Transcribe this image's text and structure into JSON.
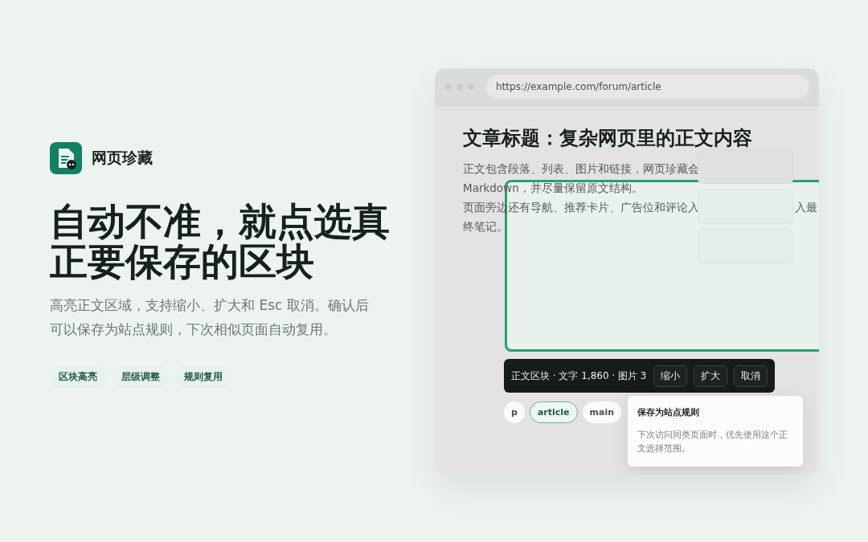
{
  "app": {
    "name": "网页珍藏"
  },
  "headline": "自动不准，就点选真正要保存的区块",
  "description": "高亮正文区域，支持缩小、扩大和 Esc 取消。确认后可以保存为站点规则，下次相似页面自动复用。",
  "tags": [
    "区块高亮",
    "层级调整",
    "规则复用"
  ],
  "browser": {
    "url": "https://example.com/forum/article",
    "article_title": "文章标题：复杂网页里的正文内容",
    "paragraph_lines": [
      {
        "text": "正文包含段落、列表、图片和链接，网页珍藏会"
      },
      {
        "text": "Markdown，并尽量保留原文结构。"
      },
      {
        "text": "页面旁边还有导航、推荐卡片、广告位和评论入",
        "tail": "入最"
      },
      {
        "text": "终笔记。"
      }
    ]
  },
  "selection_toolbar": {
    "info": "正文区块 · 文字 1,860 · 图片 3",
    "buttons": [
      "缩小",
      "扩大",
      "取消"
    ]
  },
  "element_path": [
    {
      "label": "p",
      "selected": false
    },
    {
      "label": "article",
      "selected": true
    },
    {
      "label": "main",
      "selected": false
    }
  ],
  "tooltip": {
    "title": "保存为站点规则",
    "body": "下次访问同类页面时，优先使用这个正文选择范围。"
  }
}
